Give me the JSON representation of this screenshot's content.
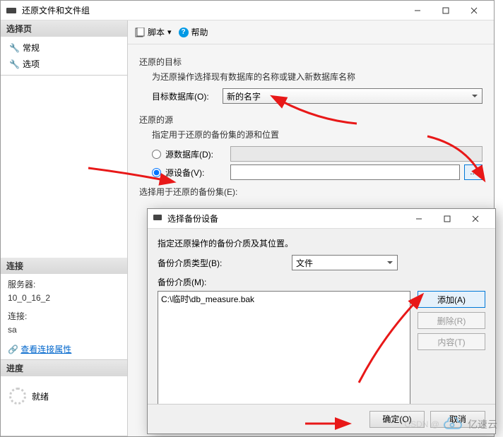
{
  "mainWindow": {
    "title": "还原文件和文件组",
    "sidebar": {
      "selectPage": {
        "header": "选择页",
        "items": [
          "常规",
          "选项"
        ]
      },
      "connection": {
        "header": "连接",
        "serverLabel": "服务器:",
        "server": "10_0_16_2",
        "connLabel": "连接:",
        "conn": "sa",
        "viewProps": "查看连接属性"
      },
      "progress": {
        "header": "进度",
        "status": "就绪"
      }
    },
    "toolbar": {
      "script": "脚本",
      "help": "帮助"
    },
    "form": {
      "restoreTarget": {
        "section": "还原的目标",
        "desc": "为还原操作选择现有数据库的名称或键入新数据库名称",
        "label": "目标数据库(O):",
        "value": "新的名字"
      },
      "restoreSource": {
        "section": "还原的源",
        "desc": "指定用于还原的备份集的源和位置",
        "radioDb": "源数据库(D):",
        "radioDev": "源设备(V):"
      },
      "backupSets": {
        "label": "选择用于还原的备份集(E):"
      }
    }
  },
  "innerDialog": {
    "title": "选择备份设备",
    "desc": "指定还原操作的备份介质及其位置。",
    "mediaTypeLabel": "备份介质类型(B):",
    "mediaTypeValue": "文件",
    "mediaLabel": "备份介质(M):",
    "listItem": "C:\\临时\\db_measure.bak",
    "buttons": {
      "add": "添加(A)",
      "remove": "删除(R)",
      "contents": "内容(T)",
      "ok": "确定(O)",
      "cancel": "取消"
    }
  },
  "watermark": {
    "csdn": "CSDN @",
    "brand": "亿速云"
  }
}
